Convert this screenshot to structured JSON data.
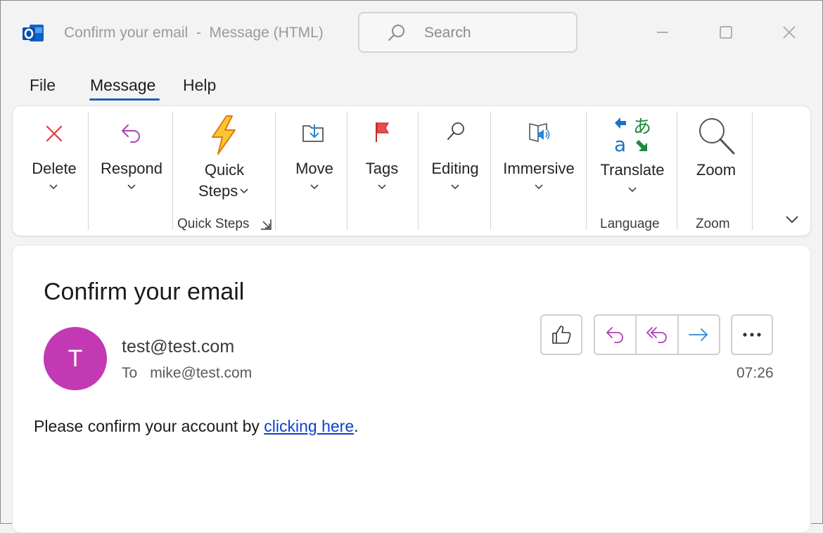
{
  "window": {
    "title": "Confirm your email  -  Message (HTML)",
    "search_placeholder": "Search"
  },
  "menu": {
    "tabs": [
      {
        "label": "File"
      },
      {
        "label": "Message",
        "active": true
      },
      {
        "label": "Help"
      }
    ]
  },
  "ribbon": {
    "delete": {
      "label": "Delete",
      "icon": "close-x-icon"
    },
    "respond": {
      "label": "Respond",
      "icon": "reply-icon"
    },
    "quick_steps": {
      "label_line1": "Quick",
      "label_line2": "Steps",
      "icon": "lightning-icon"
    },
    "move": {
      "label": "Move",
      "icon": "move-to-folder-icon"
    },
    "tags": {
      "label": "Tags",
      "icon": "flag-icon"
    },
    "editing": {
      "label": "Editing",
      "icon": "search-icon"
    },
    "immersive": {
      "label": "Immersive",
      "icon": "immersive-reader-icon"
    },
    "translate": {
      "label": "Translate",
      "icon": "translate-icon"
    },
    "zoom": {
      "label": "Zoom",
      "icon": "magnifier-icon"
    },
    "groups": {
      "quick_steps": "Quick Steps",
      "language": "Language",
      "zoom": "Zoom"
    }
  },
  "message": {
    "subject": "Confirm your email",
    "avatar_initial": "T",
    "sender": "test@test.com",
    "to_label": "To",
    "recipient": "mike@test.com",
    "time": "07:26",
    "body_prefix": "Please confirm your account by ",
    "body_link": "clicking here",
    "body_suffix": "."
  },
  "colors": {
    "accent": "#1f5fb0",
    "avatar": "#c239b3",
    "link": "#0f3fcf",
    "reply_purple": "#b13fb8",
    "forward_blue": "#2b88d8"
  }
}
